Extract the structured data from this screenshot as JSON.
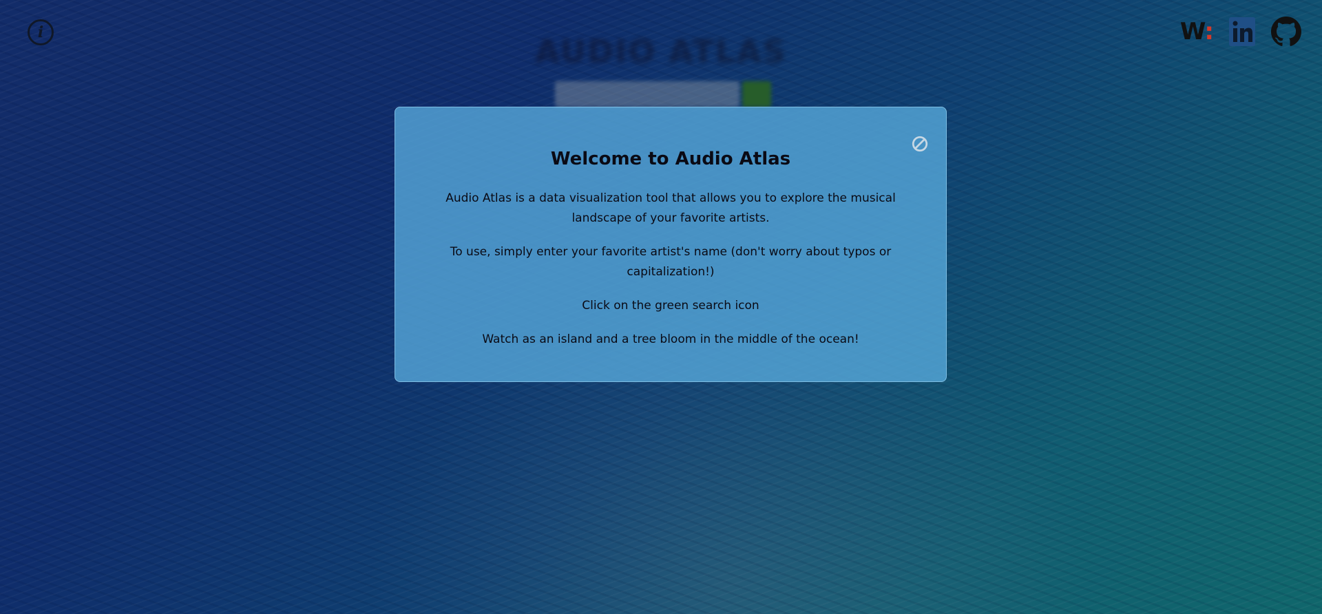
{
  "app": {
    "title": "AUDIO ATLAS"
  },
  "search": {
    "placeholder": "",
    "button_color": "#3c8a2c",
    "button_icon": "search-icon"
  },
  "header": {
    "info_icon": "info-icon",
    "info_glyph": "i"
  },
  "social": {
    "items": [
      {
        "name": "website-link",
        "icon": "w-logo-icon",
        "text": "W",
        "accent": ":"
      },
      {
        "name": "linkedin-link",
        "icon": "linkedin-icon"
      },
      {
        "name": "github-link",
        "icon": "github-icon"
      }
    ],
    "linkedin_color": "#1f4f86"
  },
  "modal": {
    "title": "Welcome to Audio Atlas",
    "paragraphs": [
      "Audio Atlas is a data visualization tool that allows you to explore the musical landscape of your favorite artists.",
      "To use, simply enter your favorite artist's name (don't worry about typos or capitalization!)",
      "Click on the green search icon",
      "Watch as an island and a tree bloom in the middle of the ocean!"
    ],
    "close_icon": "close-icon",
    "background": "#58aadc"
  }
}
